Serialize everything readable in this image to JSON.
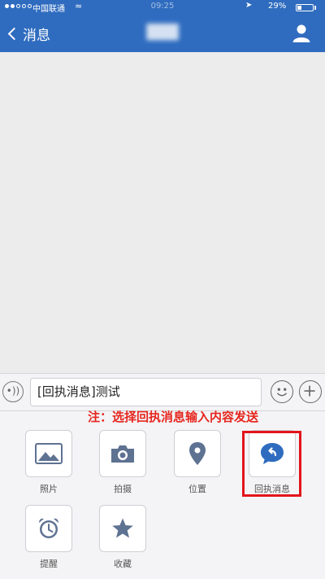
{
  "status_bar": {
    "carrier": "中国联通",
    "time": "09:25",
    "battery": "29%"
  },
  "header": {
    "back_label": "消息",
    "title": "███"
  },
  "composer": {
    "value": "[回执消息]测试"
  },
  "annotation": "注：选择回执消息输入内容发送",
  "panel": {
    "items": [
      {
        "label": "照片",
        "icon": "photo-icon"
      },
      {
        "label": "拍摄",
        "icon": "camera-icon"
      },
      {
        "label": "位置",
        "icon": "location-pin-icon"
      },
      {
        "label": "回执消息",
        "icon": "receipt-message-icon"
      },
      {
        "label": "提醒",
        "icon": "alarm-clock-icon"
      },
      {
        "label": "收藏",
        "icon": "star-icon"
      }
    ]
  },
  "colors": {
    "header": "#2f6cbf",
    "accent_icon": "#5e7292",
    "annotation": "#e6261f"
  }
}
